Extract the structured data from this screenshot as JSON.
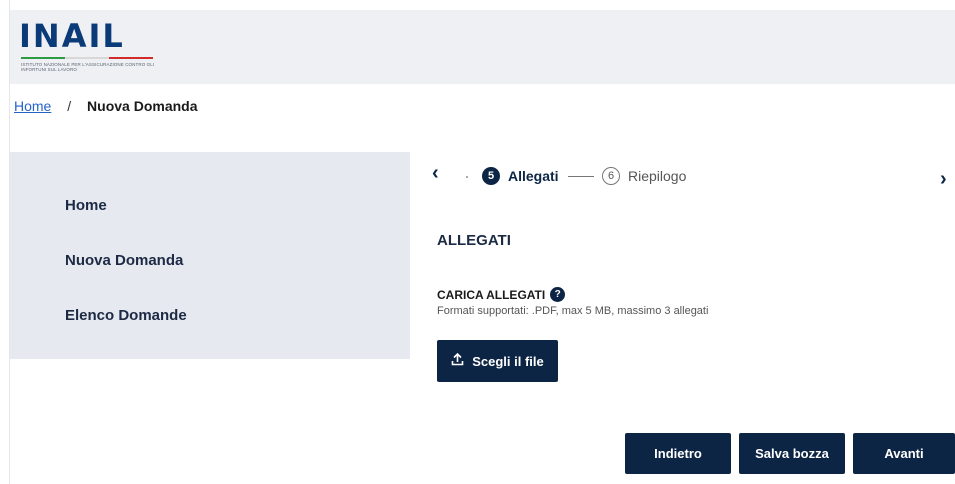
{
  "header": {
    "logo_text": "INAIL",
    "logo_subtitle": "ISTITUTO NAZIONALE PER L'ASSICURAZIONE CONTRO GLI INFORTUNI SUL LAVORO"
  },
  "breadcrumb": {
    "home": "Home",
    "separator": "/",
    "current": "Nuova Domanda"
  },
  "sidebar": {
    "items": [
      {
        "label": "Home"
      },
      {
        "label": "Nuova Domanda"
      },
      {
        "label": "Elenco Domande"
      }
    ]
  },
  "stepper": {
    "prev_icon": "chevron-left-icon",
    "next_icon": "chevron-right-icon",
    "steps": [
      {
        "number": "5",
        "label": "Allegati",
        "state": "active"
      },
      {
        "number": "6",
        "label": "Riepilogo",
        "state": "inactive"
      }
    ]
  },
  "main": {
    "section_title": "ALLEGATI",
    "upload_label": "CARICA ALLEGATI",
    "help_icon": "?",
    "upload_hint": "Formati supportati: .PDF, max 5 MB, massimo 3 allegati",
    "choose_file_label": "Scegli il file"
  },
  "actions": {
    "back_label": "Indietro",
    "save_draft_label": "Salva bozza",
    "next_label": "Avanti"
  },
  "colors": {
    "primary": "#0d2545",
    "link": "#2563c9",
    "sidebar_bg": "#e6e9ef",
    "header_bg": "#eef0f3"
  }
}
